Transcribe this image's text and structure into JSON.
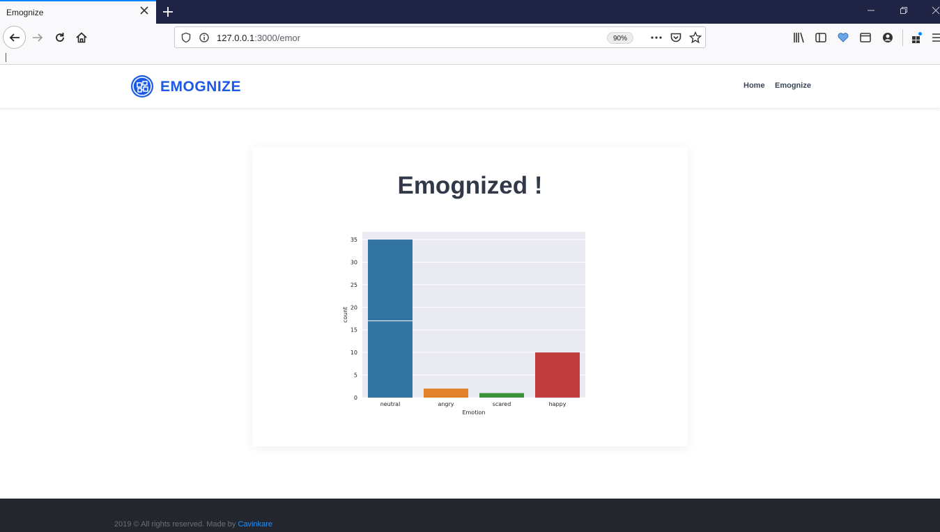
{
  "browser": {
    "tab_title": "Emognize",
    "url_host": "127.0.0.1",
    "url_path": ":3000/emor",
    "zoom": "90%"
  },
  "site": {
    "brand": "EMOGNIZE",
    "brand_color": "#1b59e6",
    "nav": [
      {
        "label": "Home"
      },
      {
        "label": "Emognize"
      }
    ]
  },
  "main": {
    "title": "Emognized !"
  },
  "chart_data": {
    "type": "bar",
    "categories": [
      "neutral",
      "angry",
      "scared",
      "happy"
    ],
    "values": [
      35,
      2,
      1,
      10
    ],
    "colors": [
      "#3274a1",
      "#e1812c",
      "#3a923a",
      "#c03d3e"
    ],
    "xlabel": "Emotion",
    "ylabel": "count",
    "ylim": [
      0,
      36.7
    ],
    "yticks": [
      0,
      5,
      10,
      15,
      20,
      25,
      30,
      35
    ],
    "background": "#eaeaf2",
    "grid": true
  },
  "footer": {
    "text": "2019 © All rights reserved. Made by",
    "link": "Cavinkare"
  }
}
